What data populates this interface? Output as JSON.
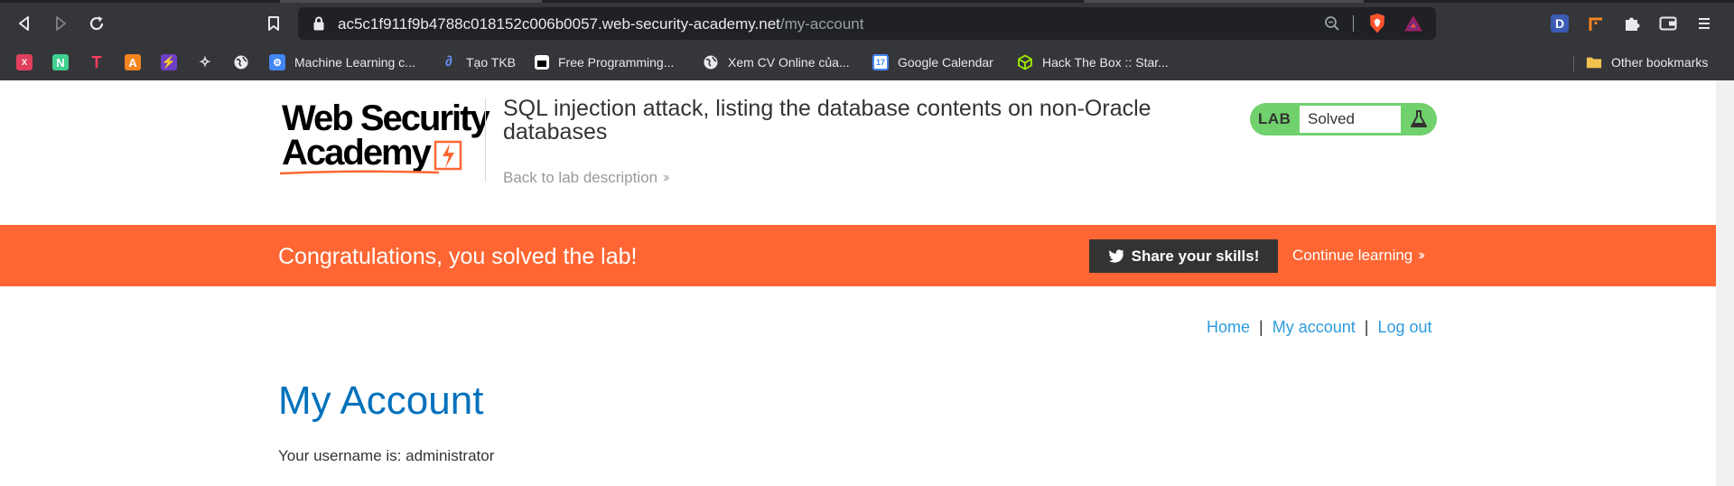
{
  "browser": {
    "url_host": "ac5c1f911f9b4788c018152c006b0057.web-security-academy.net",
    "url_path": "/my-account",
    "bookmarks": [
      {
        "label": "",
        "icon": "xmind-icon",
        "color": "#e0405b"
      },
      {
        "label": "",
        "icon": "notion-n-icon",
        "color": "#3fcf8e"
      },
      {
        "label": "",
        "icon": "t-logo-icon",
        "color": "#ff3b5c"
      },
      {
        "label": "",
        "icon": "a-logo-icon",
        "color": "#f5851f"
      },
      {
        "label": "",
        "icon": "bolt-icon",
        "color": "#8b5cf6"
      },
      {
        "label": "",
        "icon": "feather-icon",
        "color": "#e8eaed"
      },
      {
        "label": "",
        "icon": "globe-icon",
        "color": "#e8eaed"
      },
      {
        "label": "Machine Learning c...",
        "icon": "robot-icon",
        "color": "#4285f4"
      },
      {
        "label": "Tạo TKB",
        "icon": "swirl-icon",
        "color": "#6b8ff7"
      },
      {
        "label": "Free Programming...",
        "icon": "box-icon",
        "color": "#ffffff"
      },
      {
        "label": "Xem CV Online của...",
        "icon": "globe-icon",
        "color": "#e8eaed"
      },
      {
        "label": "Google Calendar",
        "icon": "calendar-icon",
        "color": "#4285f4",
        "badge": "17"
      },
      {
        "label": "Hack The Box :: Star...",
        "icon": "cube-icon",
        "color": "#9fef00"
      }
    ],
    "other_bookmarks": "Other bookmarks"
  },
  "header": {
    "logo_line1": "Web Security",
    "logo_line2": "Academy",
    "lab_title": "SQL injection attack, listing the database contents on non-Oracle databases",
    "back_link": "Back to lab description",
    "lab_tag": "LAB",
    "lab_status": "Solved"
  },
  "banner": {
    "message": "Congratulations, you solved the lab!",
    "share": "Share your skills!",
    "continue": "Continue learning"
  },
  "nav": {
    "home": "Home",
    "account": "My account",
    "logout": "Log out",
    "separator": "|"
  },
  "main": {
    "title": "My Account",
    "username_line": "Your username is: administrator"
  },
  "colors": {
    "accent_orange": "#ff6633",
    "lab_green": "#70d16d",
    "link_blue": "#2d9bde",
    "title_blue": "#0071bc"
  }
}
